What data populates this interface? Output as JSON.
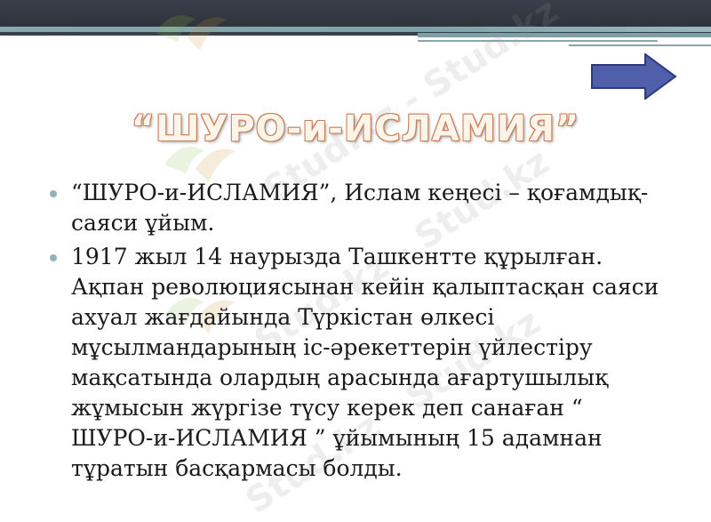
{
  "slide": {
    "title": "“ШУРО-и-ИСЛАМИЯ”",
    "bullets": [
      "“ШУРО-и-ИСЛАМИЯ”, Ислам кеңесі – қоғамдық-саяси ұйым.",
      "1917 жыл 14 наурызда Ташкентте құрылған. Ақпан революциясынан кейін қалыптасқан саяси ахуал жағдайында Түркістан өлкесі мұсылмандарының іс-әрекеттерін үйлестіру мақсатында олардың арасында ағартушылық жұмысын жүргізе түсу керек деп санаған “ ШУРО-и-ИСЛАМИЯ ” ұйымының 15 адамнан тұратын басқармасы болды."
    ]
  },
  "navigation": {
    "next_icon": "right-arrow-icon"
  },
  "watermark": {
    "text": "Stud.kz - Stud.kz"
  },
  "colors": {
    "header_dark": "#2f343c",
    "header_teal": "#7fa3aa",
    "title_outline": "#c97d55",
    "title_fill": "#fdf4ea",
    "bullet_dot": "#8fb3b9",
    "arrow_fill": "#4f5faa",
    "body_text": "#1a1a1a"
  }
}
